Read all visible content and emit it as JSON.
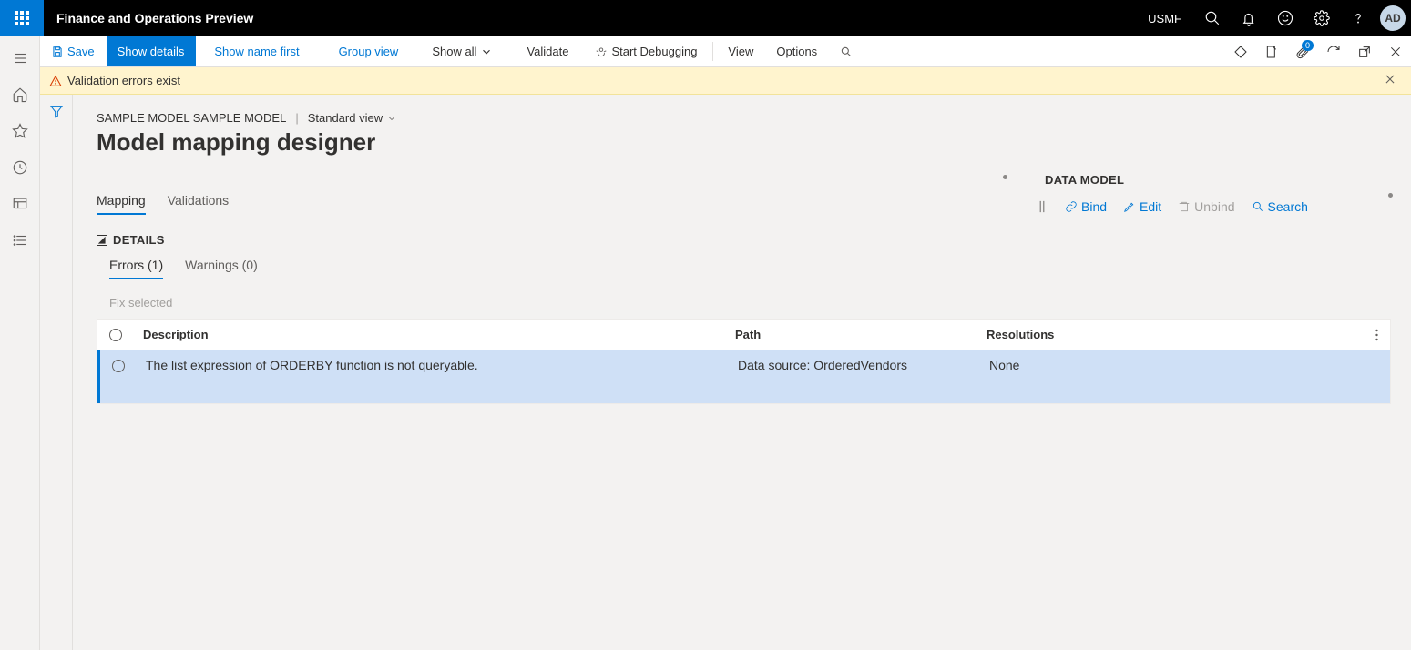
{
  "topbar": {
    "app_title": "Finance and Operations Preview",
    "company": "USMF",
    "avatar_initials": "AD"
  },
  "cmdbar": {
    "save": "Save",
    "show_details": "Show details",
    "show_name_first": "Show name first",
    "group_view": "Group view",
    "show_all": "Show all",
    "validate": "Validate",
    "start_debugging": "Start Debugging",
    "view": "View",
    "options": "Options",
    "attach_badge": "0"
  },
  "banner": {
    "message": "Validation errors exist"
  },
  "breadcrumb": {
    "path": "SAMPLE MODEL SAMPLE MODEL",
    "view": "Standard view"
  },
  "page_title": "Model mapping designer",
  "tabs": {
    "mapping": "Mapping",
    "validations": "Validations"
  },
  "details": {
    "header": "DETAILS",
    "subtab_errors": "Errors (1)",
    "subtab_warnings": "Warnings (0)",
    "fix_selected": "Fix selected"
  },
  "datamodel": {
    "header": "DATA MODEL",
    "bind": "Bind",
    "edit": "Edit",
    "unbind": "Unbind",
    "search": "Search"
  },
  "grid": {
    "columns": {
      "description": "Description",
      "path": "Path",
      "resolutions": "Resolutions"
    },
    "row": {
      "description": "The list expression of ORDERBY function is not queryable.",
      "path": "Data source: OrderedVendors",
      "resolutions": "None"
    }
  }
}
